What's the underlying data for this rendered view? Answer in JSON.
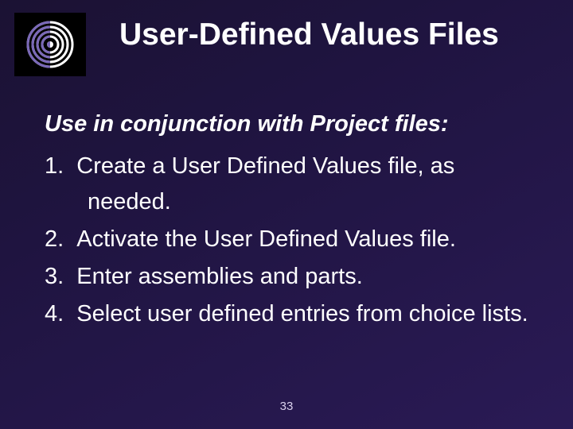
{
  "title": "User-Defined Values Files",
  "lead": "Use in conjunction with Project files:",
  "items": [
    "1.  Create a User Defined Values file, as needed.",
    "2.  Activate the User Defined Values file.",
    "3.  Enter assemblies and parts.",
    "4.  Select user defined entries from choice lists."
  ],
  "page_number": "33"
}
